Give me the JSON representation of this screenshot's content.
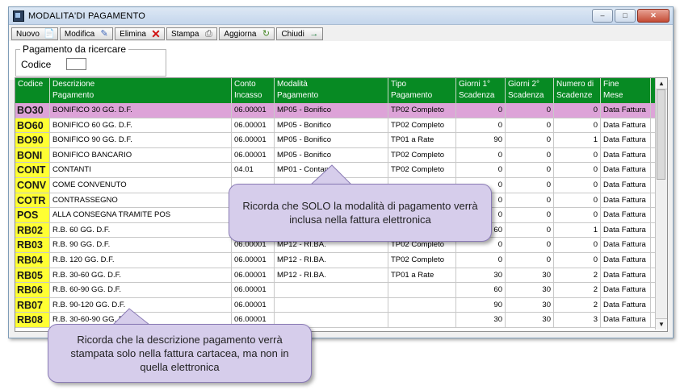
{
  "window": {
    "title": "MODALITA'DI PAGAMENTO",
    "controls": [
      "minimize",
      "maximize",
      "close"
    ]
  },
  "toolbar": {
    "buttons": [
      {
        "label": "Nuovo",
        "icon": "new-document-icon"
      },
      {
        "label": "Modifica",
        "icon": "edit-pen-icon"
      },
      {
        "label": "Elimina",
        "icon": "delete-x-icon"
      },
      {
        "label": "Stampa",
        "icon": "printer-icon"
      },
      {
        "label": "Aggiorna",
        "icon": "refresh-icon"
      },
      {
        "label": "Chiudi",
        "icon": "exit-door-icon"
      }
    ]
  },
  "search": {
    "legend": "Pagamento da ricercare",
    "code_label": "Codice",
    "code_value": ""
  },
  "table": {
    "columns": [
      [
        "Codice",
        ""
      ],
      [
        "Descrizione",
        "Pagamento"
      ],
      [
        "Conto",
        "Incasso"
      ],
      [
        "Modalità",
        "Pagamento"
      ],
      [
        "Tipo",
        "Pagamento"
      ],
      [
        "Giorni 1°",
        "Scadenza"
      ],
      [
        "Giorni 2°",
        "Scadenza"
      ],
      [
        "Numero di",
        "Scadenze"
      ],
      [
        "Fine",
        "Mese"
      ]
    ],
    "rows": [
      [
        "BO30",
        "BONIFICO 30 GG. D.F.",
        "06.00001",
        "MP05 - Bonifico",
        "TP02 Completo",
        "0",
        "0",
        "0",
        "Data Fattura"
      ],
      [
        "BO60",
        "BONIFICO 60 GG. D.F.",
        "06.00001",
        "MP05 - Bonifico",
        "TP02 Completo",
        "0",
        "0",
        "0",
        "Data Fattura"
      ],
      [
        "BO90",
        "BONIFICO 90 GG. D.F.",
        "06.00001",
        "MP05 - Bonifico",
        "TP01 a Rate",
        "90",
        "0",
        "1",
        "Data Fattura"
      ],
      [
        "BONI",
        "BONIFICO BANCARIO",
        "06.00001",
        "MP05 - Bonifico",
        "TP02 Completo",
        "0",
        "0",
        "0",
        "Data Fattura"
      ],
      [
        "CONT",
        "CONTANTI",
        "04.01",
        "MP01 - Contanti",
        "TP02 Completo",
        "0",
        "0",
        "0",
        "Data Fattura"
      ],
      [
        "CONV",
        "COME CONVENUTO",
        "",
        "",
        "",
        "0",
        "0",
        "0",
        "Data Fattura"
      ],
      [
        "COTR",
        "CONTRASSEGNO",
        "",
        "",
        "",
        "0",
        "0",
        "0",
        "Data Fattura"
      ],
      [
        "POS",
        "ALLA CONSEGNA TRAMITE POS",
        "",
        "",
        "",
        "0",
        "0",
        "0",
        "Data Fattura"
      ],
      [
        "RB02",
        "R.B. 60 GG. D.F.",
        "",
        "",
        "",
        "60",
        "0",
        "1",
        "Data Fattura"
      ],
      [
        "RB03",
        "R.B. 90 GG. D.F.",
        "06.00001",
        "MP12 - RI.BA.",
        "TP02 Completo",
        "0",
        "0",
        "0",
        "Data Fattura"
      ],
      [
        "RB04",
        "R.B. 120 GG. D.F.",
        "06.00001",
        "MP12 - RI.BA.",
        "TP02 Completo",
        "0",
        "0",
        "0",
        "Data Fattura"
      ],
      [
        "RB05",
        "R.B. 30-60 GG. D.F.",
        "06.00001",
        "MP12 - RI.BA.",
        "TP01 a Rate",
        "30",
        "30",
        "2",
        "Data Fattura"
      ],
      [
        "RB06",
        "R.B. 60-90 GG. D.F.",
        "06.00001",
        "",
        "",
        "60",
        "30",
        "2",
        "Data Fattura"
      ],
      [
        "RB07",
        "R.B. 90-120 GG. D.F.",
        "06.00001",
        "",
        "",
        "90",
        "30",
        "2",
        "Data Fattura"
      ],
      [
        "RB08",
        "R.B. 30-60-90 GG. D.F.",
        "06.00001",
        "",
        "",
        "30",
        "30",
        "3",
        "Data Fattura"
      ]
    ],
    "selected_row": 0
  },
  "callouts": {
    "modalita": "Ricorda che SOLO la modalità di pagamento verrà inclusa nella fattura elettronica",
    "descrizione": "Ricorda che la descrizione pagamento verrà stampata solo nella fattura cartacea, ma non in quella elettronica"
  },
  "colors": {
    "header_green": "#078a23",
    "code_yellow": "#ffff33",
    "selected_row": "#dda3d8",
    "callout_fill": "#d6cdeb"
  }
}
